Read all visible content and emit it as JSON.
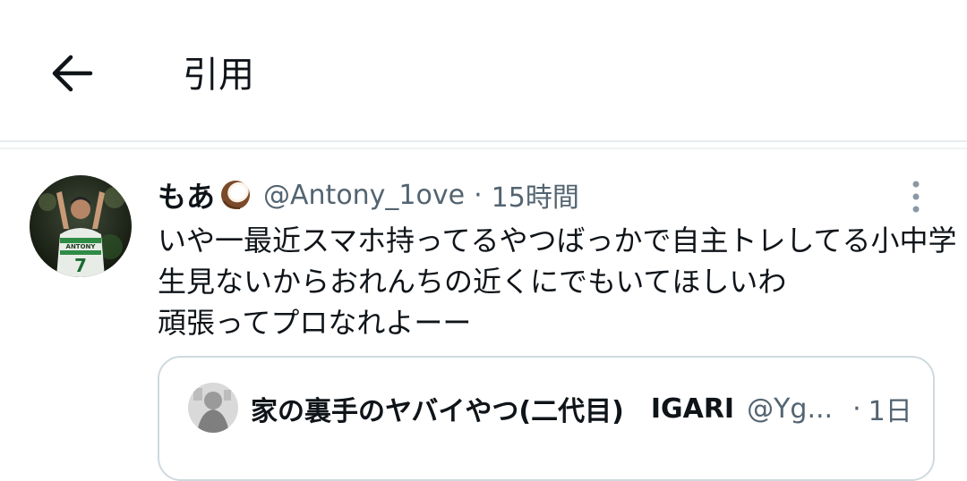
{
  "header": {
    "back_icon": "arrow-left-icon",
    "title": "引用"
  },
  "tweet": {
    "display_name": "もあ",
    "emoji": "coconut-emoji",
    "handle": "@Antony_1ove",
    "separator": "·",
    "time": "15時間",
    "more_icon": "more-vertical-icon",
    "text_lines": [
      "いや一最近スマホ持ってるやつばっかで自主トレしてる小中学",
      "生見ないからおれんちの近くにでもいてほしいわ",
      "頑張ってプロなれよーー"
    ],
    "avatar_text": "ANTONY",
    "avatar_number": "7"
  },
  "quote": {
    "display_name": "家の裏手のヤバイやつ(二代目)",
    "name_suffix": "IGARI",
    "handle": "@Yg...",
    "separator": "·",
    "time": "1日"
  },
  "colors": {
    "text": "#0f1419",
    "secondary": "#536471",
    "border": "#cfd9de"
  }
}
